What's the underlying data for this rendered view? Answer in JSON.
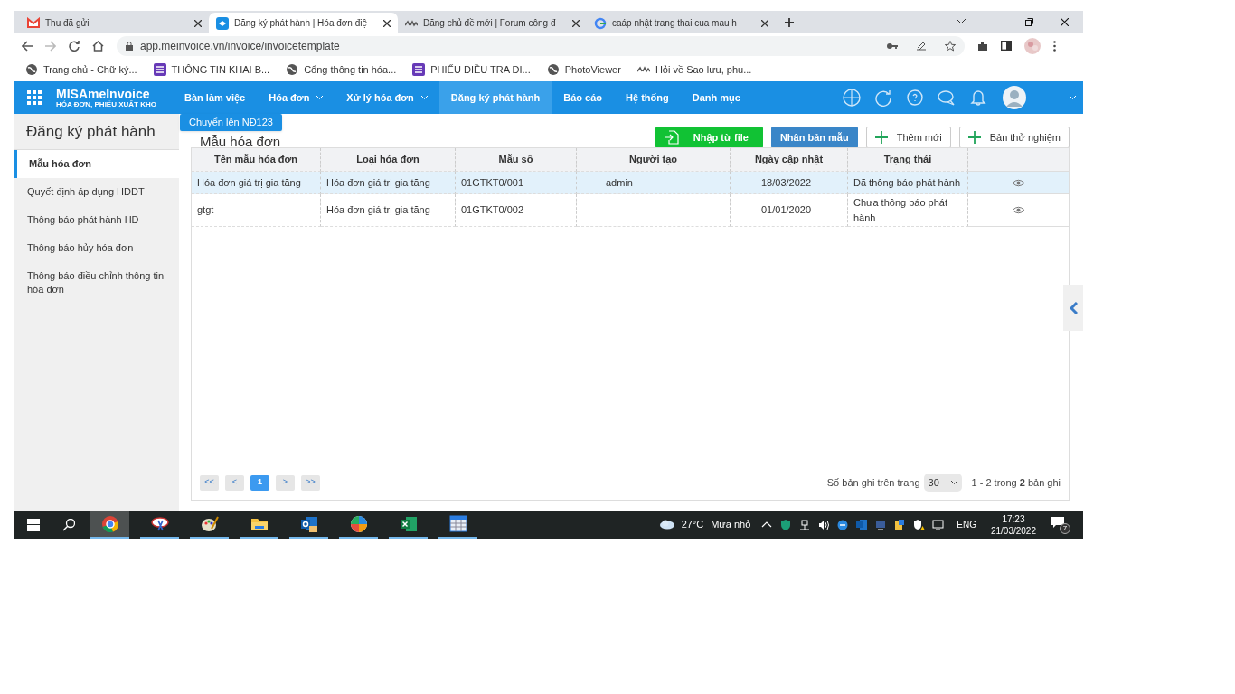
{
  "browser": {
    "tabs": [
      {
        "title": "Thu đã gửi",
        "kind": "mail",
        "selected": false
      },
      {
        "title": "Đăng ký phát hành | Hóa đơn điệ",
        "kind": "app",
        "selected": true
      },
      {
        "title": "Đăng chủ đề mới | Forum công đ",
        "kind": "forum",
        "selected": false
      },
      {
        "title": "caáp nhật trang thai cua mau h",
        "kind": "google",
        "selected": false
      }
    ],
    "url": "app.meinvoice.vn/invoice/invoicetemplate",
    "bookmarks": [
      {
        "label": "Trang chủ - Chữ ký...",
        "kind": "globe"
      },
      {
        "label": "THÔNG TIN KHAI B...",
        "kind": "form"
      },
      {
        "label": "Cổng thông tin hóa...",
        "kind": "globe"
      },
      {
        "label": "PHIẾU ĐIỀU TRA DI...",
        "kind": "form"
      },
      {
        "label": "PhotoViewer",
        "kind": "globe"
      },
      {
        "label": "Hỏi về Sao lưu, phu...",
        "kind": "forum"
      }
    ]
  },
  "app": {
    "logo": {
      "name": "MISAmeInvoice",
      "tagline": "HÓA ĐƠN, PHIẾU XUẤT KHO"
    },
    "nav": [
      {
        "label": "Bàn làm việc",
        "dropdown": false,
        "selected": false
      },
      {
        "label": "Hóa đơn",
        "dropdown": true,
        "selected": false
      },
      {
        "label": "Xử lý hóa đơn",
        "dropdown": true,
        "selected": false
      },
      {
        "label": "Đăng ký phát hành",
        "dropdown": false,
        "selected": true
      },
      {
        "label": "Báo cáo",
        "dropdown": false,
        "selected": false
      },
      {
        "label": "Hệ thống",
        "dropdown": false,
        "selected": false
      },
      {
        "label": "Danh mục",
        "dropdown": false,
        "selected": false
      }
    ]
  },
  "sidebar": {
    "title": "Đăng ký phát hành",
    "items": [
      {
        "label": "Mẫu hóa đơn",
        "selected": true
      },
      {
        "label": "Quyết định áp dụng HĐĐT",
        "selected": false
      },
      {
        "label": "Thông báo phát hành HĐ",
        "selected": false
      },
      {
        "label": "Thông báo hủy hóa đơn",
        "selected": false
      },
      {
        "label": "Thông báo điều chỉnh thông tin hóa đơn",
        "selected": false
      }
    ]
  },
  "tooltip": "Chuyển lên NĐ123",
  "heading": "Mẫu hóa đơn",
  "toolbar": [
    {
      "label": "Nhập từ file",
      "kind": "import"
    },
    {
      "label": "Nhân bản mẫu",
      "kind": "primary"
    },
    {
      "label": "Thêm mới",
      "kind": "add"
    },
    {
      "label": "Bản thử nghiệm",
      "kind": "add"
    }
  ],
  "table": {
    "columns": [
      "Tên mẫu hóa đơn",
      "Loại hóa đơn",
      "Mẫu số",
      "Người tạo",
      "Ngày cập nhật",
      "Trạng thái"
    ],
    "rows": [
      {
        "cells": [
          "Hóa đơn giá trị gia tăng",
          "Hóa đơn giá trị gia tăng",
          "01GTKT0/001",
          "admin",
          "18/03/2022",
          "Đã thông báo phát hành"
        ],
        "selected": true
      },
      {
        "cells": [
          "gtgt",
          "Hóa đơn giá trị gia tăng",
          "01GTKT0/002",
          "",
          "01/01/2020",
          "Chưa thông báo phát hành"
        ],
        "selected": false
      }
    ]
  },
  "pagination": {
    "pages": [
      {
        "label": "<<",
        "selected": false
      },
      {
        "label": "<",
        "selected": false
      },
      {
        "label": "1",
        "selected": true
      },
      {
        "label": ">",
        "selected": false
      },
      {
        "label": ">>",
        "selected": false
      }
    ],
    "page_size_label": "Số bản ghi trên trang",
    "page_size": "30",
    "summary": "1 - 2 trong **2** bản ghi"
  },
  "taskbar": {
    "apps": [
      {
        "kind": "chrome",
        "selected": true
      },
      {
        "kind": "snip",
        "selected": false
      },
      {
        "kind": "paint",
        "selected": false
      },
      {
        "kind": "folder",
        "selected": false
      },
      {
        "kind": "outlook",
        "selected": false
      },
      {
        "kind": "wheel",
        "selected": false
      },
      {
        "kind": "excel",
        "selected": false
      },
      {
        "kind": "grid",
        "selected": false
      }
    ],
    "temperature": "27°C",
    "weather": "Mưa nhỏ",
    "language": "ENG",
    "time": "17:23",
    "date": "21/03/2022",
    "notifications": "7"
  }
}
